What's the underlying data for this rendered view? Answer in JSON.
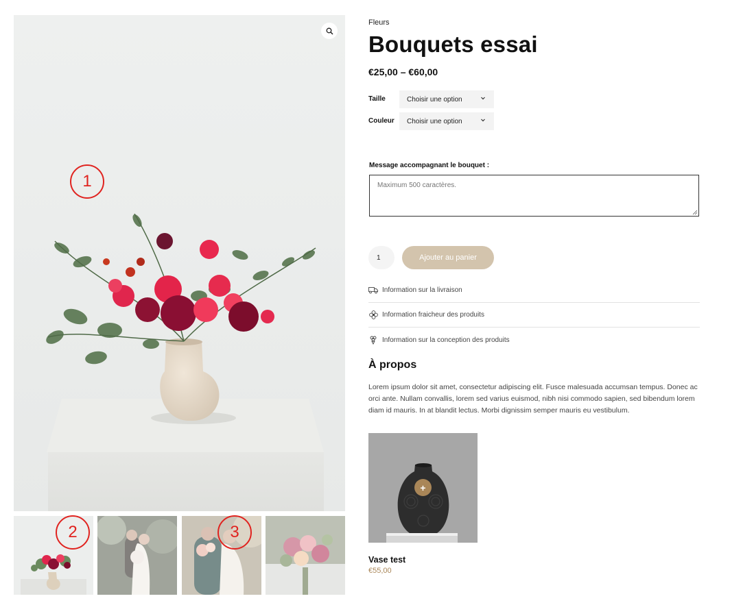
{
  "product": {
    "category": "Fleurs",
    "title": "Bouquets essai",
    "price": "€25,00 – €60,00"
  },
  "variations": [
    {
      "label": "Taille",
      "selected": "Choisir une option"
    },
    {
      "label": "Couleur",
      "selected": "Choisir une option"
    }
  ],
  "message": {
    "label": "Message accompagnant le bouquet :",
    "placeholder": "Maximum 500 caractères."
  },
  "cart": {
    "quantity": "1",
    "add_label": "Ajouter au panier"
  },
  "info": [
    {
      "icon": "truck-icon",
      "label": "Information sur la livraison"
    },
    {
      "icon": "flower-icon",
      "label": "Information fraicheur des produits"
    },
    {
      "icon": "bouquet-icon",
      "label": "Information sur la conception des produits"
    }
  ],
  "about": {
    "title": "À propos",
    "text": "Lorem ipsum dolor sit amet, consectetur adipiscing elit. Fusce malesuada accumsan tempus. Donec ac orci ante. Nullam convallis, lorem sed varius euismod, nibh nisi commodo sapien, sed bibendum lorem diam id mauris. In at blandit lectus. Morbi dignissim semper mauris eu vestibulum."
  },
  "related": {
    "name": "Vase test",
    "price": "€55,00",
    "plus": "+"
  },
  "annotations": [
    "1",
    "2",
    "3"
  ],
  "gallery": {
    "zoom_icon": "magnifier-icon",
    "thumbnails": [
      "bouquet-vase",
      "wedding-couple-1",
      "wedding-couple-2",
      "bouquet-close"
    ]
  },
  "colors": {
    "accent": "#a98658",
    "add_to_cart_bg": "#d3c4ad",
    "annotation_red": "#e0231f"
  }
}
